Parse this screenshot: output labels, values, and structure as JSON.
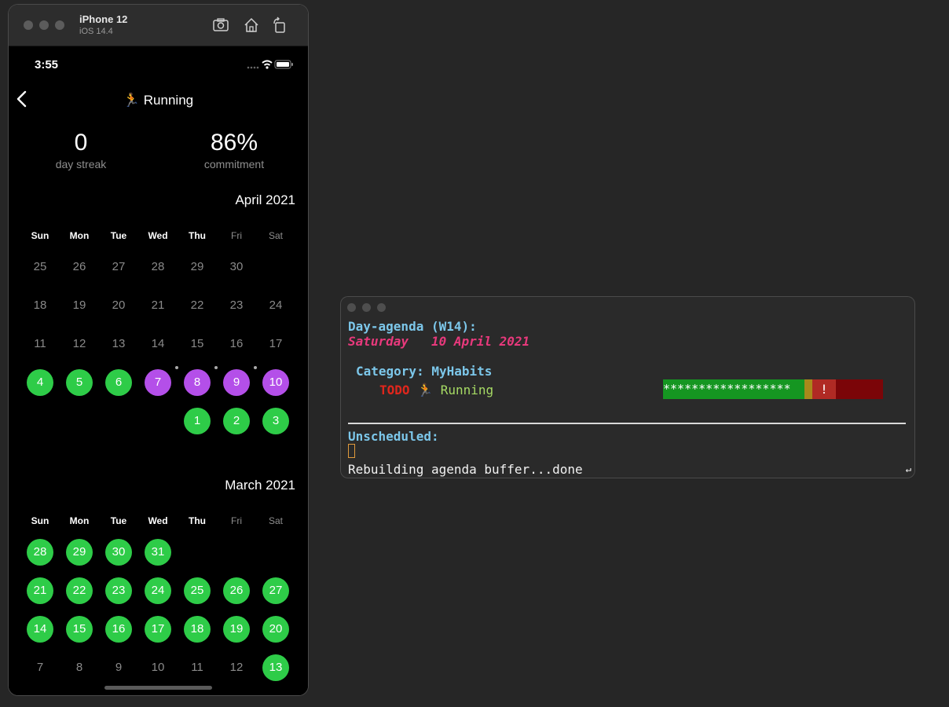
{
  "simulator": {
    "device": "iPhone 12",
    "os": "iOS 14.4",
    "status_time": "3:55",
    "nav_title": "🏃 Running",
    "streak_value": "0",
    "streak_label": "day streak",
    "commitment_value": "86%",
    "commitment_label": "commitment",
    "weekdays": [
      "Sun",
      "Mon",
      "Tue",
      "Wed",
      "Thu",
      "Fri",
      "Sat"
    ],
    "months": [
      {
        "title": "April 2021",
        "rows": [
          [
            {
              "d": "25",
              "s": "none"
            },
            {
              "d": "26",
              "s": "none"
            },
            {
              "d": "27",
              "s": "none"
            },
            {
              "d": "28",
              "s": "none"
            },
            {
              "d": "29",
              "s": "none"
            },
            {
              "d": "30",
              "s": "none"
            },
            null
          ],
          [
            {
              "d": "18",
              "s": "none"
            },
            {
              "d": "19",
              "s": "none"
            },
            {
              "d": "20",
              "s": "none"
            },
            {
              "d": "21",
              "s": "none"
            },
            {
              "d": "22",
              "s": "none"
            },
            {
              "d": "23",
              "s": "none"
            },
            {
              "d": "24",
              "s": "none"
            }
          ],
          [
            {
              "d": "11",
              "s": "none"
            },
            {
              "d": "12",
              "s": "none"
            },
            {
              "d": "13",
              "s": "none"
            },
            {
              "d": "14",
              "s": "none"
            },
            {
              "d": "15",
              "s": "none"
            },
            {
              "d": "16",
              "s": "none"
            },
            {
              "d": "17",
              "s": "none"
            }
          ],
          [
            {
              "d": "4",
              "s": "green"
            },
            {
              "d": "5",
              "s": "green"
            },
            {
              "d": "6",
              "s": "green"
            },
            {
              "d": "7",
              "s": "purple",
              "dot": true
            },
            {
              "d": "8",
              "s": "purple",
              "dot": true
            },
            {
              "d": "9",
              "s": "purple",
              "dot": true
            },
            {
              "d": "10",
              "s": "purple"
            }
          ],
          [
            null,
            null,
            null,
            null,
            {
              "d": "1",
              "s": "green"
            },
            {
              "d": "2",
              "s": "green"
            },
            {
              "d": "3",
              "s": "green"
            }
          ]
        ]
      },
      {
        "title": "March 2021",
        "rows": [
          [
            {
              "d": "28",
              "s": "green"
            },
            {
              "d": "29",
              "s": "green"
            },
            {
              "d": "30",
              "s": "green"
            },
            {
              "d": "31",
              "s": "green"
            },
            null,
            null,
            null
          ],
          [
            {
              "d": "21",
              "s": "green"
            },
            {
              "d": "22",
              "s": "green"
            },
            {
              "d": "23",
              "s": "green"
            },
            {
              "d": "24",
              "s": "green"
            },
            {
              "d": "25",
              "s": "green"
            },
            {
              "d": "26",
              "s": "green"
            },
            {
              "d": "27",
              "s": "green"
            }
          ],
          [
            {
              "d": "14",
              "s": "green"
            },
            {
              "d": "15",
              "s": "green"
            },
            {
              "d": "16",
              "s": "green"
            },
            {
              "d": "17",
              "s": "green"
            },
            {
              "d": "18",
              "s": "green"
            },
            {
              "d": "19",
              "s": "green"
            },
            {
              "d": "20",
              "s": "green"
            }
          ],
          [
            {
              "d": "7",
              "s": "none"
            },
            {
              "d": "8",
              "s": "none"
            },
            {
              "d": "9",
              "s": "none"
            },
            {
              "d": "10",
              "s": "none"
            },
            {
              "d": "11",
              "s": "none"
            },
            {
              "d": "12",
              "s": "none"
            },
            {
              "d": "13",
              "s": "green"
            }
          ]
        ]
      }
    ],
    "colors": {
      "green": "#2ecc48",
      "purple": "#b44fe9"
    }
  },
  "terminal": {
    "header": "Day-agenda (W14):",
    "day_name": "Saturday",
    "date": "10 April 2021",
    "category_line": "Category: MyHabits",
    "todo_keyword": "TODO",
    "todo_title": "🏃 Running",
    "consistency_stars": "******************",
    "consistency_mark": "!",
    "unscheduled_label": "Unscheduled:",
    "echo_message": "Rebuilding agenda buffer...done",
    "wrap_indicator": "↵"
  }
}
